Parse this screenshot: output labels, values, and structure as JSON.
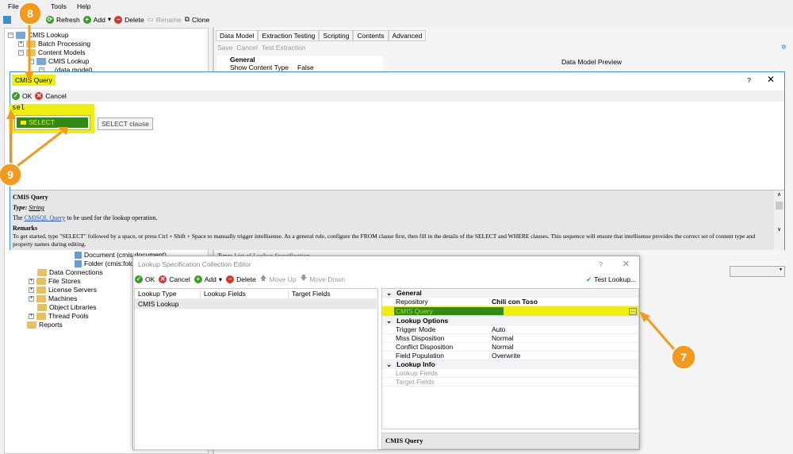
{
  "menu": [
    "File",
    "Tools",
    "Help"
  ],
  "toolbar": {
    "refresh": "Refresh",
    "add": "Add",
    "delete": "Delete",
    "rename": "Rename",
    "clone": "Clone"
  },
  "tree": {
    "root": "CMIS Lookup",
    "items": [
      "Batch Processing",
      "Content Models",
      "CMIS Lookup",
      "(data model)"
    ],
    "lower": [
      "Document (cmis:document)",
      "Folder (cmis:folde",
      "Data Connections",
      "File Stores",
      "License Servers",
      "Machines",
      "Object Libraries",
      "Thread Pools",
      "Reports"
    ]
  },
  "tabs": [
    "Data Model",
    "Extraction Testing",
    "Scripting",
    "Contents",
    "Advanced"
  ],
  "subtoolbar": {
    "save": "Save",
    "cancel": "Cancel",
    "test": "Test Extraction"
  },
  "bg_grid": {
    "category": "General",
    "key": "Show Content Type",
    "value": "False"
  },
  "preview_label": "Data Model Preview",
  "type_line": {
    "prefix": "Type:",
    "text": "List of Lookup Specification"
  },
  "query_dialog": {
    "title": "CMIS Query",
    "help": "?",
    "ok": "OK",
    "cancel": "Cancel",
    "editor_text": "sel",
    "completion": "SELECT",
    "tooltip": "SELECT clause",
    "help_panel": {
      "heading": "CMIS Query",
      "type_label": "Type:",
      "type_value": "String",
      "desc_pre": "The",
      "desc_link": "CMISQL Query",
      "desc_post": "to be used for the lookup operation.",
      "remarks": "Remarks",
      "remarks_text": "To get started, type \"SELECT\" followed by a space, or press Ctrl + Shift + Space to manually trigger intellisense. As a general rule, configure the FROM clause first, then fill in the details of the SELECT and WHERE clauses. This sequence will ensure that intellisense provides the correct set of content type and property names during editing."
    }
  },
  "lookup_editor": {
    "title": "Lookup Specification Collection Editor",
    "help": "?",
    "ok": "OK",
    "cancel": "Cancel",
    "add": "Add",
    "delete": "Delete",
    "move_up": "Move Up",
    "move_down": "Move Down",
    "test": "Test Lookup...",
    "columns": [
      "Lookup Type",
      "Lookup Fields",
      "Target Fields"
    ],
    "rows": [
      [
        "CMIS Lookup",
        "",
        ""
      ]
    ],
    "props": {
      "general": "General",
      "repository": "Repository",
      "repository_value": "Chili con Toso",
      "cmis_query": "CMIS Query",
      "options": "Lookup Options",
      "trigger": "Trigger Mode",
      "trigger_v": "Auto",
      "miss": "Miss Disposition",
      "miss_v": "Normal",
      "conflict": "Conflict Disposition",
      "conflict_v": "Normal",
      "population": "Field Population",
      "population_v": "Overwrite",
      "info": "Lookup Info",
      "lookup_fields": "Lookup Fields",
      "target_fields": "Target Fields"
    },
    "description_title": "CMIS Query"
  },
  "callouts": [
    "8",
    "9",
    "7"
  ],
  "colors": {
    "callout": "#f39a1e",
    "highlight": "#eeee10",
    "selection": "#2e8b1a"
  }
}
